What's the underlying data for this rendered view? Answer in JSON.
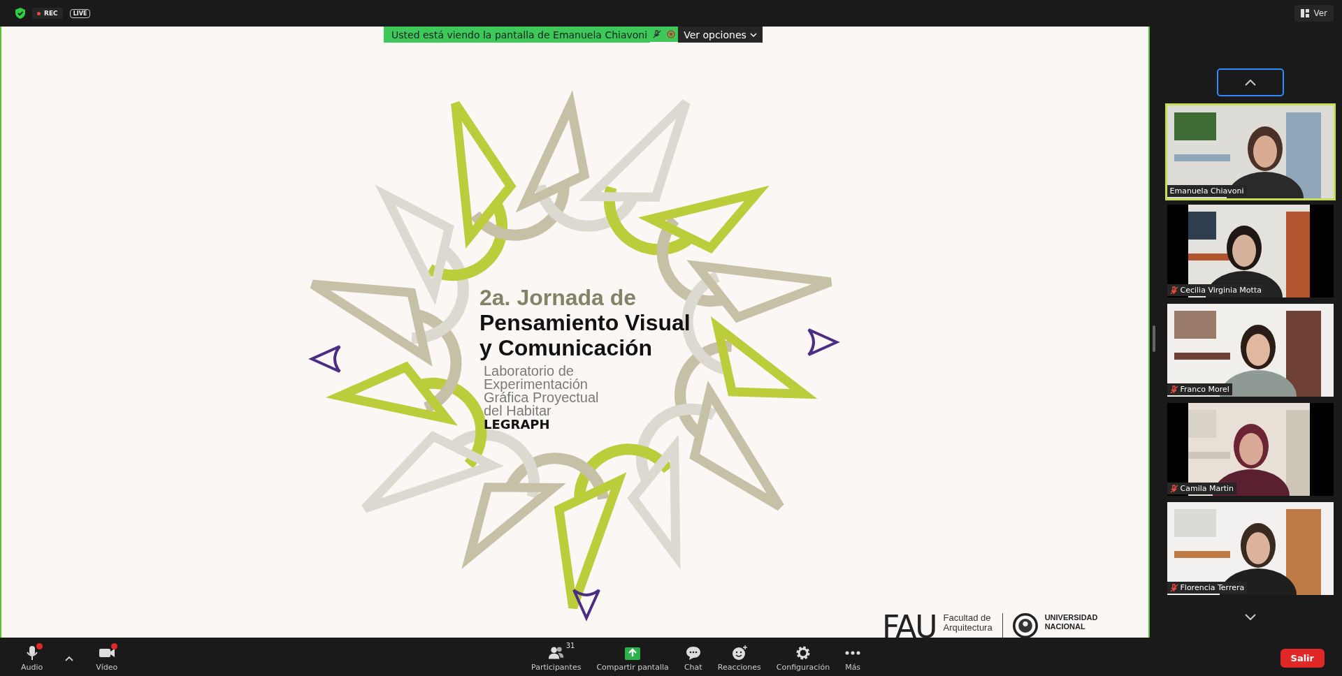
{
  "top_bar": {
    "badges": [
      {
        "kind": "shield"
      },
      {
        "kind": "rec",
        "label": "REC"
      },
      {
        "kind": "live",
        "label": "LIVE"
      }
    ],
    "view_button": "Ver"
  },
  "share_banner": {
    "text": "Usted está viendo la pantalla de Emanuela Chiavoni",
    "options_button": "Ver opciones"
  },
  "slide": {
    "title_line": "2a. Jornada de",
    "headline": [
      "Pensamiento Visual",
      "y Comunicación"
    ],
    "subtitle": [
      "Laboratorio de",
      "Experimentación",
      "Gráfica Proyectual",
      "del Habitar"
    ],
    "acronym": "LEGRAPH",
    "logos": {
      "fau": "FAU",
      "faculty": [
        "Facultad de",
        "Arquitectura"
      ],
      "university": [
        "UNIVERSIDAD",
        "NACIONAL"
      ]
    }
  },
  "participants": [
    {
      "name": "Emanuela Chiavoni",
      "muted": false,
      "selected": true
    },
    {
      "name": "Cecilia Virginia Motta",
      "muted": true,
      "selected": false
    },
    {
      "name": "Franco Morel",
      "muted": true,
      "selected": false
    },
    {
      "name": "Camila Martin",
      "muted": true,
      "selected": false
    },
    {
      "name": "Florencia Terrera",
      "muted": true,
      "selected": false
    }
  ],
  "toolbar": {
    "left": [
      {
        "kind": "audio",
        "label": "Audio",
        "alert": true
      },
      {
        "kind": "caret"
      },
      {
        "kind": "video",
        "label": "Vídeo",
        "alert": true
      }
    ],
    "center": [
      {
        "kind": "participants",
        "label": "Participantes",
        "count": "31"
      },
      {
        "kind": "share",
        "label": "Compartir pantalla"
      },
      {
        "kind": "chat",
        "label": "Chat"
      },
      {
        "kind": "reactions",
        "label": "Reacciones"
      },
      {
        "kind": "settings",
        "label": "Configuración"
      },
      {
        "kind": "more",
        "label": "Más"
      }
    ],
    "leave_button": "Salir"
  }
}
